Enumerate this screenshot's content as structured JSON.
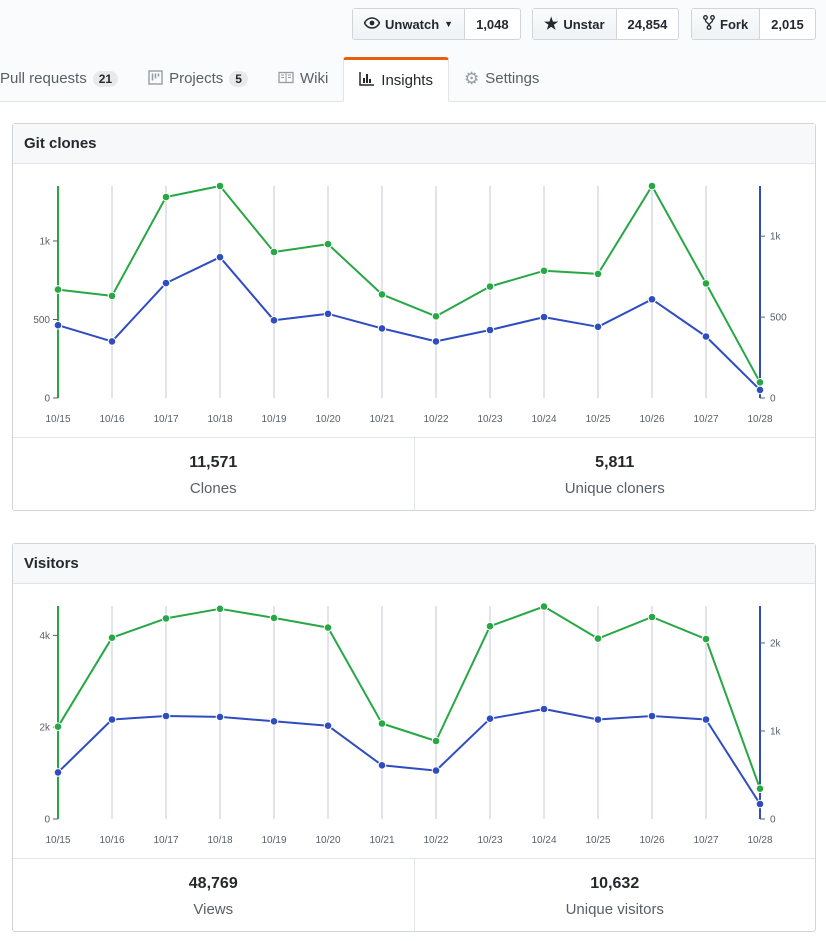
{
  "header": {
    "watch": {
      "label": "Unwatch",
      "count": "1,048"
    },
    "star": {
      "label": "Unstar",
      "count": "24,854"
    },
    "fork": {
      "label": "Fork",
      "count": "2,015"
    }
  },
  "tabs": [
    {
      "label": "Pull requests",
      "count": "21"
    },
    {
      "label": "Projects",
      "count": "5"
    },
    {
      "label": "Wiki"
    },
    {
      "label": "Insights"
    },
    {
      "label": "Settings"
    }
  ],
  "clones": {
    "title": "Git clones",
    "stats": [
      {
        "value": "11,571",
        "label": "Clones"
      },
      {
        "value": "5,811",
        "label": "Unique cloners"
      }
    ]
  },
  "visitors": {
    "title": "Visitors",
    "stats": [
      {
        "value": "48,769",
        "label": "Views"
      },
      {
        "value": "10,632",
        "label": "Unique visitors"
      }
    ]
  },
  "colors": {
    "total": "#28a745",
    "unique": "#2f4cc0",
    "accent": "#e36209"
  },
  "chart_data": [
    {
      "type": "line",
      "x": [
        "10/15",
        "10/16",
        "10/17",
        "10/18",
        "10/19",
        "10/20",
        "10/21",
        "10/22",
        "10/23",
        "10/24",
        "10/25",
        "10/26",
        "10/27",
        "10/28"
      ],
      "left_axis": {
        "ticks": [
          0,
          500,
          1000
        ],
        "tick_labels": [
          "0",
          "500",
          "1k"
        ],
        "ylim": [
          0,
          1350
        ]
      },
      "right_axis": {
        "ticks": [
          0,
          500,
          1000
        ],
        "tick_labels": [
          "0",
          "500",
          "1k"
        ],
        "ylim": [
          0,
          1310
        ]
      },
      "series": [
        {
          "role": "total",
          "axis": "left",
          "values": [
            690,
            650,
            1280,
            1350,
            930,
            980,
            660,
            520,
            710,
            810,
            790,
            1350,
            730,
            100
          ]
        },
        {
          "role": "unique",
          "axis": "right",
          "values": [
            450,
            350,
            710,
            870,
            480,
            520,
            430,
            350,
            420,
            500,
            440,
            610,
            380,
            50
          ]
        }
      ]
    },
    {
      "type": "line",
      "x": [
        "10/15",
        "10/16",
        "10/17",
        "10/18",
        "10/19",
        "10/20",
        "10/21",
        "10/22",
        "10/23",
        "10/24",
        "10/25",
        "10/26",
        "10/27",
        "10/28"
      ],
      "left_axis": {
        "ticks": [
          0,
          2000,
          4000
        ],
        "tick_labels": [
          "0",
          "2k",
          "4k"
        ],
        "ylim": [
          0,
          4640
        ]
      },
      "right_axis": {
        "ticks": [
          0,
          1000,
          2000
        ],
        "tick_labels": [
          "0",
          "1k",
          "2k"
        ],
        "ylim": [
          0,
          2420
        ]
      },
      "series": [
        {
          "role": "total",
          "axis": "left",
          "values": [
            2010,
            3950,
            4370,
            4580,
            4380,
            4170,
            2080,
            1700,
            4200,
            4630,
            3930,
            4400,
            3920,
            660
          ]
        },
        {
          "role": "unique",
          "axis": "right",
          "values": [
            530,
            1130,
            1170,
            1160,
            1110,
            1060,
            610,
            550,
            1140,
            1250,
            1130,
            1170,
            1130,
            170
          ]
        }
      ]
    }
  ]
}
